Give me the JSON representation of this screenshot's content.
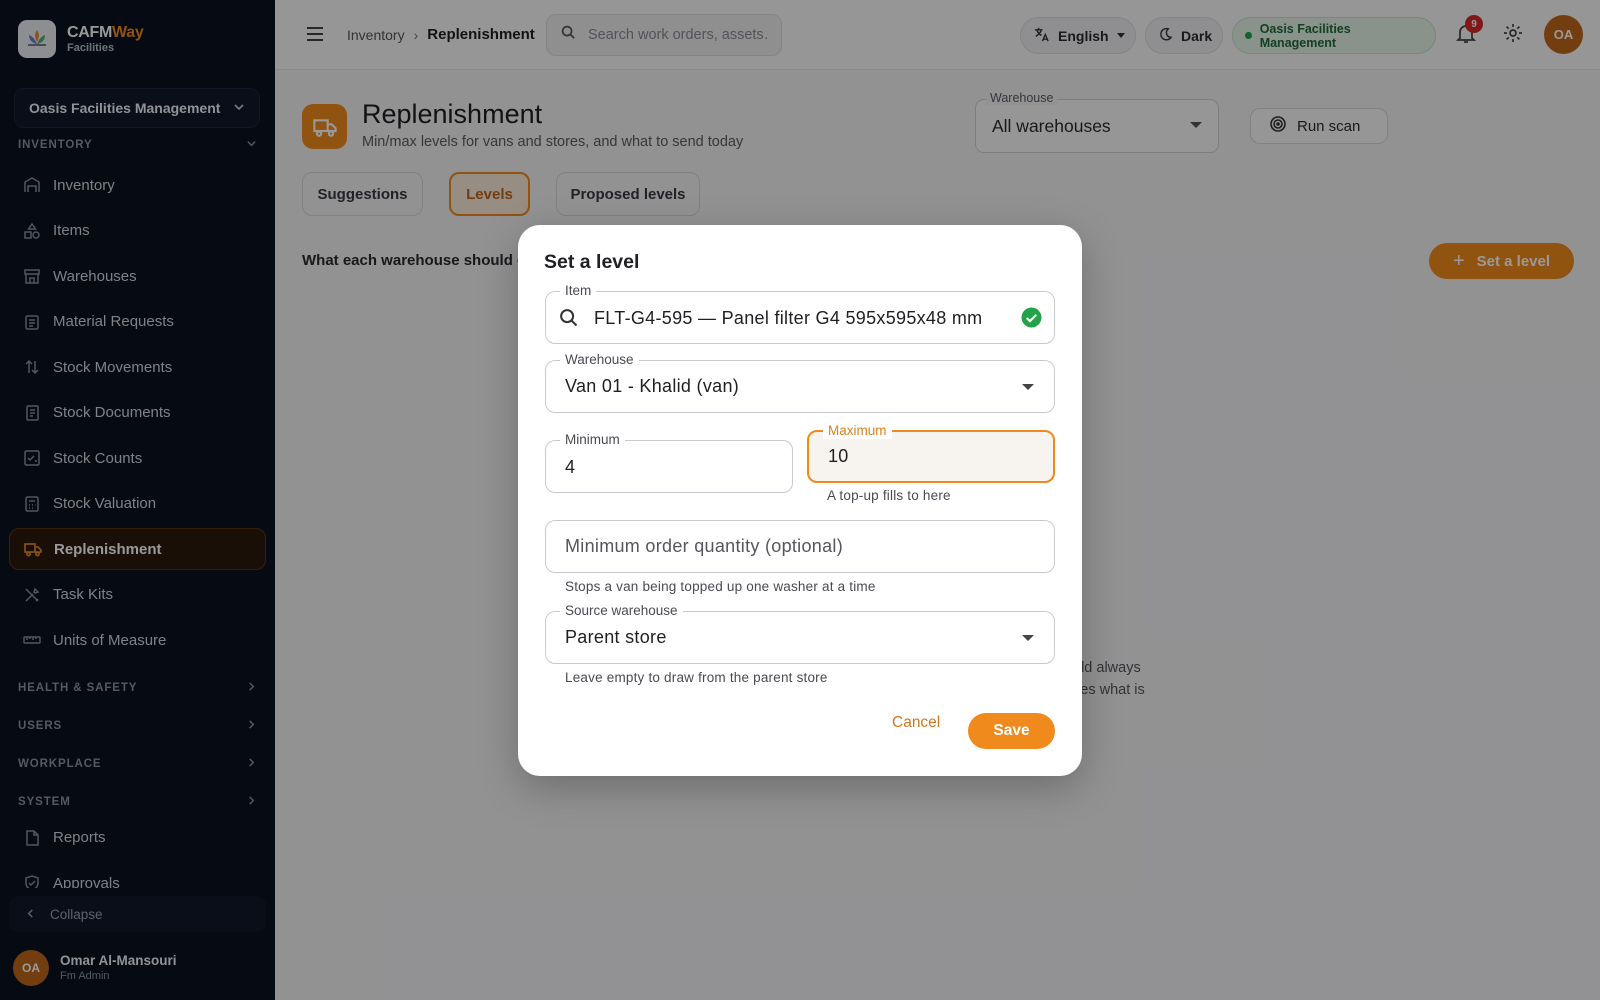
{
  "colors": {
    "accent": "#f08a1c",
    "sidebar_bg": "#0b1220",
    "success": "#22a249",
    "badge": "#d62828"
  },
  "brand": {
    "name_part1": "CAFM",
    "name_part2": "Way",
    "subtitle": "Facilities",
    "logo_icon": "lotus-logo-icon"
  },
  "sidebar": {
    "org": "Oasis Facilities Management",
    "inventory_section": "INVENTORY",
    "inventory_items": [
      {
        "label": "Inventory",
        "icon": "warehouse-icon"
      },
      {
        "label": "Items",
        "icon": "shapes-icon"
      },
      {
        "label": "Warehouses",
        "icon": "store-icon"
      },
      {
        "label": "Material Requests",
        "icon": "clipboard-icon"
      },
      {
        "label": "Stock Movements",
        "icon": "arrows-updown-icon"
      },
      {
        "label": "Stock Documents",
        "icon": "document-icon"
      },
      {
        "label": "Stock Counts",
        "icon": "checklist-icon"
      },
      {
        "label": "Stock Valuation",
        "icon": "calculator-icon"
      },
      {
        "label": "Replenishment",
        "icon": "truck-icon",
        "active": true
      },
      {
        "label": "Task Kits",
        "icon": "tools-icon"
      },
      {
        "label": "Units of Measure",
        "icon": "ruler-icon"
      }
    ],
    "sections": [
      "HEALTH & SAFETY",
      "USERS",
      "WORKPLACE",
      "SYSTEM"
    ],
    "system_items": [
      {
        "label": "Reports",
        "icon": "report-icon"
      },
      {
        "label": "Approvals",
        "icon": "shield-check-icon"
      }
    ],
    "collapse_label": "Collapse",
    "user": {
      "initials": "OA",
      "name": "Omar Al-Mansouri",
      "role": "Fm Admin"
    }
  },
  "topbar": {
    "breadcrumb": [
      "Inventory",
      "Replenishment"
    ],
    "search_placeholder": "Search work orders, assets…",
    "language": "English",
    "theme": "Dark",
    "org_chip": "Oasis Facilities Management",
    "notifications": "9",
    "avatar": "OA"
  },
  "page": {
    "title": "Replenishment",
    "subtitle": "Min/max levels for vans and stores, and what to send today",
    "warehouse_filter": {
      "label": "Warehouse",
      "value": "All warehouses"
    },
    "run_scan": "Run scan",
    "tabs": [
      "Suggestions",
      "Levels",
      "Proposed levels"
    ],
    "active_tab": "Levels",
    "section_text": "What each warehouse should ca",
    "add_button": "Set a level",
    "empty_line1": "uld always",
    "empty_line2": "ses what is"
  },
  "dialog": {
    "title": "Set a level",
    "item": {
      "label": "Item",
      "value": "FLT-G4-595 — Panel filter G4 595x595x48 mm"
    },
    "warehouse": {
      "label": "Warehouse",
      "value": "Van 01 - Khalid (van)"
    },
    "minimum": {
      "label": "Minimum",
      "value": "4"
    },
    "maximum": {
      "label": "Maximum",
      "value": "10",
      "helper": "A top-up fills to here"
    },
    "moq": {
      "placeholder": "Minimum order quantity (optional)",
      "helper": "Stops a van being topped up one washer at a time"
    },
    "source": {
      "label": "Source warehouse",
      "value": "Parent store",
      "helper": "Leave empty to draw from the parent store"
    },
    "cancel": "Cancel",
    "save": "Save"
  }
}
